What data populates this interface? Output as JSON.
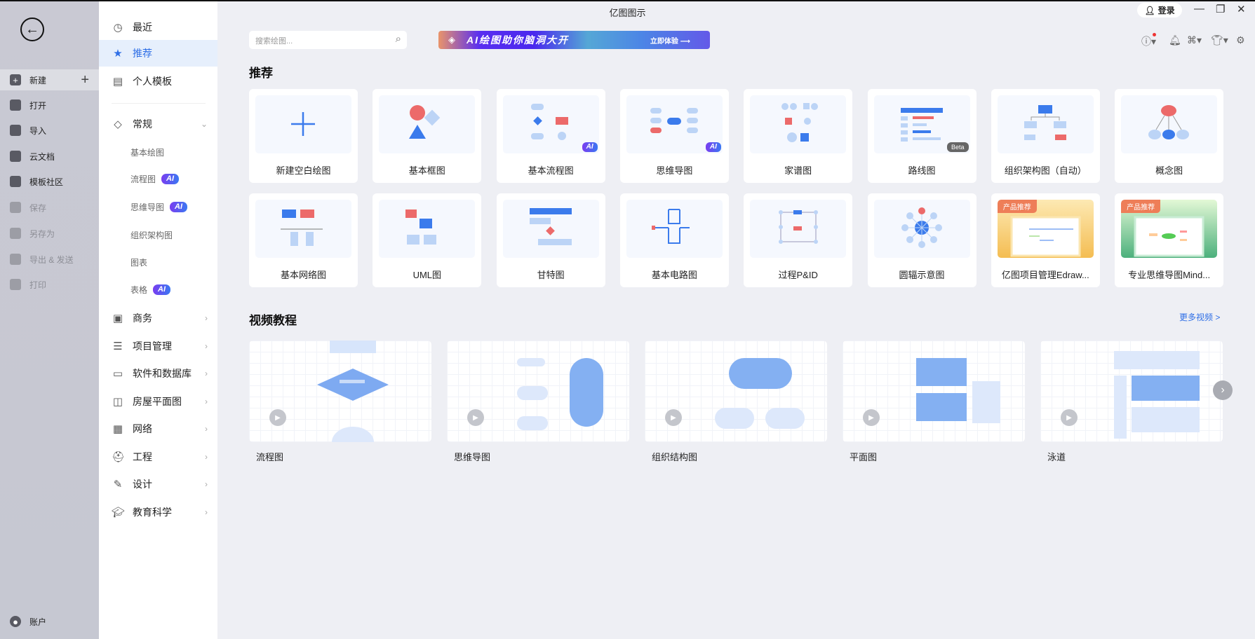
{
  "window": {
    "title": "亿图图示",
    "login": "登录"
  },
  "rail": {
    "items": [
      {
        "label": "新建",
        "icon": "plus-square-icon",
        "disabled": false
      },
      {
        "label": "打开",
        "icon": "folder-icon",
        "disabled": false
      },
      {
        "label": "导入",
        "icon": "import-icon",
        "disabled": false
      },
      {
        "label": "云文档",
        "icon": "cloud-icon",
        "disabled": false
      },
      {
        "label": "模板社区",
        "icon": "community-icon",
        "disabled": false
      },
      {
        "label": "保存",
        "icon": "save-icon",
        "disabled": true
      },
      {
        "label": "另存为",
        "icon": "save-as-icon",
        "disabled": true
      },
      {
        "label": "导出 & 发送",
        "icon": "export-icon",
        "disabled": true
      },
      {
        "label": "打印",
        "icon": "print-icon",
        "disabled": true
      }
    ],
    "account": "账户"
  },
  "side": {
    "top": [
      {
        "label": "最近"
      },
      {
        "label": "推荐"
      },
      {
        "label": "个人模板"
      }
    ],
    "general": "常规",
    "sub": [
      {
        "label": "基本绘图",
        "ai": false
      },
      {
        "label": "流程图",
        "ai": true
      },
      {
        "label": "思维导图",
        "ai": true
      },
      {
        "label": "组织架构图",
        "ai": false
      },
      {
        "label": "图表",
        "ai": false
      },
      {
        "label": "表格",
        "ai": true
      }
    ],
    "ai_label": "AI",
    "cats": [
      {
        "label": "商务"
      },
      {
        "label": "项目管理"
      },
      {
        "label": "软件和数据库"
      },
      {
        "label": "房屋平面图"
      },
      {
        "label": "网络"
      },
      {
        "label": "工程"
      },
      {
        "label": "设计"
      },
      {
        "label": "教育科学"
      }
    ]
  },
  "search": {
    "placeholder": "搜索绘图..."
  },
  "banner": {
    "text": "AI绘图助你脑洞大开",
    "cta": "立即体验"
  },
  "main": {
    "rec_title": "推荐",
    "video_title": "视频教程",
    "more_videos": "更多视频 >",
    "cards": [
      {
        "label": "新建空白绘图",
        "thumb": "plus"
      },
      {
        "label": "基本框图",
        "thumb": "shapes"
      },
      {
        "label": "基本流程图",
        "thumb": "flow",
        "badge": "AI"
      },
      {
        "label": "思维导图",
        "thumb": "mind",
        "badge": "AI"
      },
      {
        "label": "家谱图",
        "thumb": "family"
      },
      {
        "label": "路线图",
        "thumb": "road",
        "badge": "Beta"
      },
      {
        "label": "组织架构图（自动）",
        "thumb": "org"
      },
      {
        "label": "概念图",
        "thumb": "concept"
      },
      {
        "label": "基本网络图",
        "thumb": "network"
      },
      {
        "label": "UML图",
        "thumb": "uml"
      },
      {
        "label": "甘特图",
        "thumb": "gantt"
      },
      {
        "label": "基本电路图",
        "thumb": "circuit"
      },
      {
        "label": "过程P&ID",
        "thumb": "pid"
      },
      {
        "label": "圆辐示意图",
        "thumb": "radial"
      },
      {
        "label": "亿图项目管理Edraw...",
        "thumb": "promo-yellow",
        "promo": "产品推荐"
      },
      {
        "label": "专业思维导图Mind...",
        "thumb": "promo-green",
        "promo": "产品推荐"
      }
    ],
    "videos": [
      {
        "label": "流程图"
      },
      {
        "label": "思维导图"
      },
      {
        "label": "组织结构图"
      },
      {
        "label": "平面图"
      },
      {
        "label": "泳道"
      }
    ]
  }
}
